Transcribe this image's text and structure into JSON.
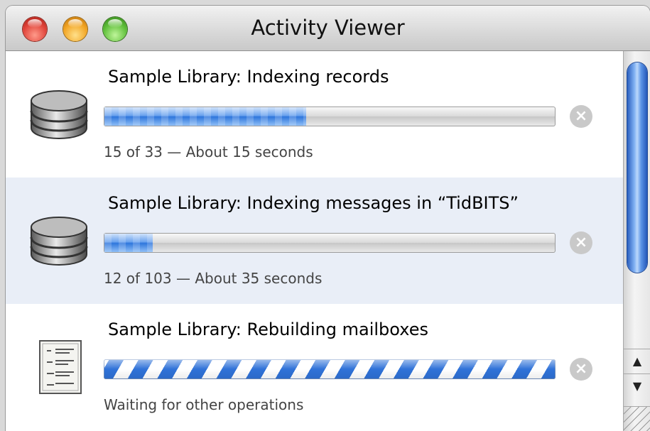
{
  "window": {
    "title": "Activity Viewer"
  },
  "activities": [
    {
      "title": "Sample Library: Indexing records",
      "status": "15 of 33 — About 15 seconds",
      "progress": 0.45,
      "indeterminate": false,
      "icon": "database-icon"
    },
    {
      "title": "Sample Library: Indexing messages in “TidBITS”",
      "status": "12 of 103 — About 35 seconds",
      "progress": 0.11,
      "indeterminate": false,
      "icon": "database-icon"
    },
    {
      "title": "Sample Library: Rebuilding mailboxes",
      "status": "Waiting for other operations",
      "progress": null,
      "indeterminate": true,
      "icon": "document-list-icon"
    }
  ],
  "icons": {
    "stop": "stop-icon",
    "scroll_up": "arrow-up-icon",
    "scroll_down": "arrow-down-icon",
    "stop_glyph": "×",
    "up_glyph": "▲",
    "down_glyph": "▼"
  },
  "colors": {
    "accent": "#2f76dc",
    "alt_row": "#e9eef7"
  }
}
